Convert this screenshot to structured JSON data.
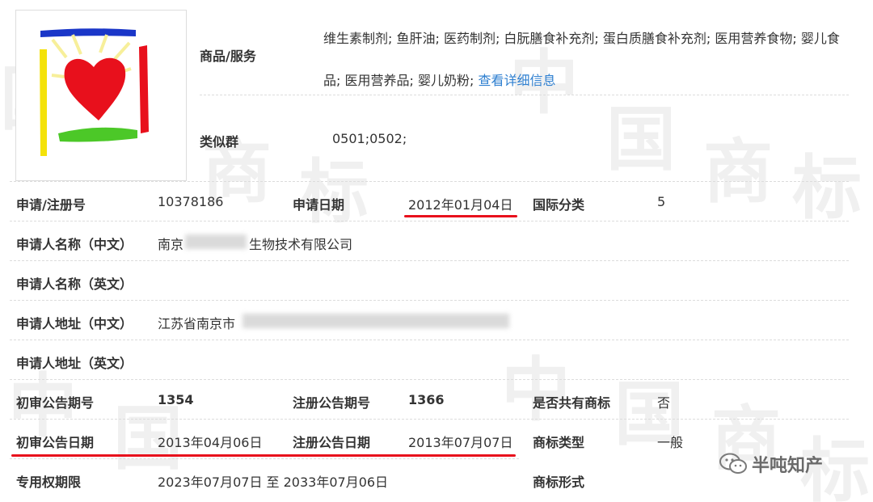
{
  "goods": {
    "label": "商品/服务",
    "text": "维生素制剂; 鱼肝油; 医药制剂; 白朊膳食补充剂; 蛋白质膳食补充剂; 医用营养食物; 婴儿食品; 医用营养品; 婴儿奶粉; ",
    "detail_link": "查看详细信息"
  },
  "similar_group": {
    "label": "类似群",
    "value": "0501;0502;"
  },
  "rows": {
    "reg_no": {
      "label": "申请/注册号",
      "value": "10378186"
    },
    "apply_date": {
      "label": "申请日期",
      "value": "2012年01月04日"
    },
    "intl_class": {
      "label": "国际分类",
      "value": "5"
    },
    "applicant_cn": {
      "label": "申请人名称（中文）",
      "value_prefix": "南京",
      "value_suffix": "生物技术有限公司"
    },
    "applicant_en": {
      "label": "申请人名称（英文）"
    },
    "address_cn": {
      "label": "申请人地址（中文）",
      "value_prefix": "江苏省南京市"
    },
    "address_en": {
      "label": "申请人地址（英文）"
    },
    "prelim_issue": {
      "label": "初审公告期号",
      "value": "1354"
    },
    "reg_issue": {
      "label": "注册公告期号",
      "value": "1366"
    },
    "shared": {
      "label": "是否共有商标",
      "value": "否"
    },
    "prelim_date": {
      "label": "初审公告日期",
      "value": "2013年04月06日"
    },
    "reg_date": {
      "label": "注册公告日期",
      "value": "2013年07月07日"
    },
    "mark_type": {
      "label": "商标类型",
      "value": "一般"
    },
    "exclusive_period": {
      "label": "专用权期限",
      "value": "2023年07月07日 至 2033年07月06日"
    },
    "mark_form": {
      "label": "商标形式"
    }
  },
  "watermark": "中国商标",
  "badge_text": "半吨知产",
  "colors": {
    "link": "#2e7fd0",
    "highlight": "#e8101c"
  }
}
